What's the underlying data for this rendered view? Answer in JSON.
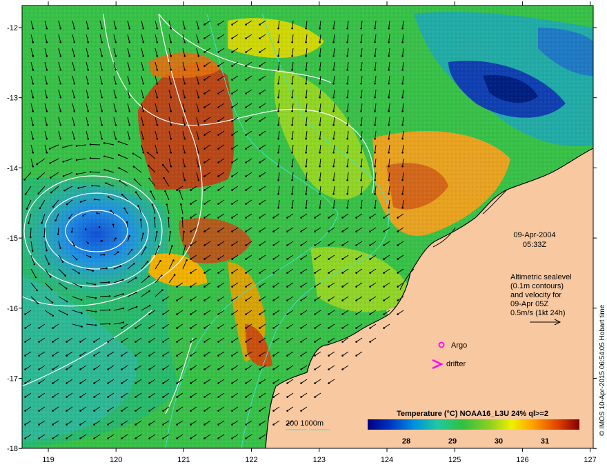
{
  "map": {
    "lon_ticks": [
      "119",
      "120",
      "121",
      "122",
      "123",
      "124",
      "125",
      "126",
      "127"
    ],
    "lat_ticks": [
      "-12",
      "-13",
      "-14",
      "-15",
      "-16",
      "-17",
      "-18"
    ],
    "date": "09-Apr-2004",
    "time": "05:33Z",
    "altimetry_lines": [
      "Altimetric sealevel",
      "(0.1m contours)",
      "and velocity for",
      "09-Apr 05Z",
      "0.5m/s (1kt 24h)"
    ],
    "argo_label": "Argo",
    "drifter_label": "drifter",
    "depth_label": "200  1000m",
    "colorbar_title": "Temperature (°C) NOAA16_L3U 24% ql>=2",
    "colorbar_ticks": [
      "28",
      "29",
      "30",
      "31"
    ],
    "credit": "© IMOS 10-Apr-2015 06:54:05 Hobart time"
  },
  "colors": {
    "land": "#f8c8a0",
    "argo_marker": "#ff00ff",
    "drifter_marker": "#ff00ff",
    "contour": "#ffffff",
    "bathymetry": "#40e0d0",
    "arrow": "#000000"
  }
}
